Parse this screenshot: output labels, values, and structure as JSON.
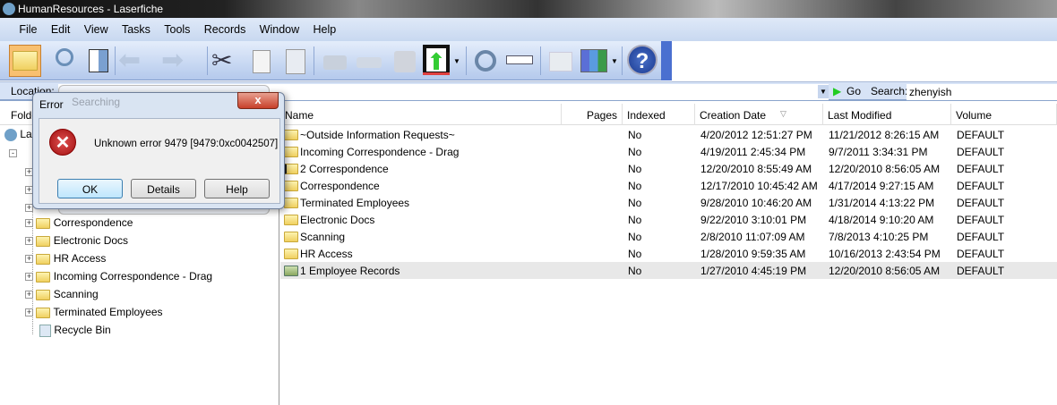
{
  "window": {
    "title": "HumanResources - Laserfiche"
  },
  "menu": [
    "File",
    "Edit",
    "View",
    "Tasks",
    "Tools",
    "Records",
    "Window",
    "Help"
  ],
  "locbar": {
    "location_label": "Location:",
    "go_label": "Go",
    "search_label": "Search:",
    "search_value": "zhenyish"
  },
  "leftpane": {
    "header": "Folders",
    "root": "Laserfiche",
    "children": [
      "Correspondence",
      "Electronic Docs",
      "HR Access",
      "Incoming Correspondence - Drag",
      "Scanning",
      "Terminated Employees",
      "Recycle Bin"
    ]
  },
  "columns": [
    "Name",
    "Pages",
    "Indexed",
    "Creation Date",
    "Last Modified",
    "Volume"
  ],
  "rows": [
    {
      "name": "~Outside Information Requests~",
      "pages": "",
      "indexed": "No",
      "created": "4/20/2012 12:51:27 PM",
      "modified": "11/21/2012 8:26:15 AM",
      "volume": "DEFAULT"
    },
    {
      "name": "Incoming Correspondence - Drag",
      "pages": "",
      "indexed": "No",
      "created": "4/19/2011 2:45:34 PM",
      "modified": "9/7/2011 3:34:31 PM",
      "volume": "DEFAULT"
    },
    {
      "name": "2 Correspondence",
      "pages": "",
      "indexed": "No",
      "created": "12/20/2010 8:55:49 AM",
      "modified": "12/20/2010 8:56:05 AM",
      "volume": "DEFAULT"
    },
    {
      "name": "Correspondence",
      "pages": "",
      "indexed": "No",
      "created": "12/17/2010 10:45:42 AM",
      "modified": "4/17/2014 9:27:15 AM",
      "volume": "DEFAULT"
    },
    {
      "name": "Terminated Employees",
      "pages": "",
      "indexed": "No",
      "created": "9/28/2010 10:46:20 AM",
      "modified": "1/31/2014 4:13:22 PM",
      "volume": "DEFAULT"
    },
    {
      "name": "Electronic Docs",
      "pages": "",
      "indexed": "No",
      "created": "9/22/2010 3:10:01 PM",
      "modified": "4/18/2014 9:10:20 AM",
      "volume": "DEFAULT"
    },
    {
      "name": "Scanning",
      "pages": "",
      "indexed": "No",
      "created": "2/8/2010 11:07:09 AM",
      "modified": "7/8/2013 4:10:25 PM",
      "volume": "DEFAULT"
    },
    {
      "name": "HR Access",
      "pages": "",
      "indexed": "No",
      "created": "1/28/2010 9:59:35 AM",
      "modified": "10/16/2013 2:43:54 PM",
      "volume": "DEFAULT"
    },
    {
      "name": "1 Employee Records",
      "pages": "",
      "indexed": "No",
      "created": "1/27/2010 4:45:19 PM",
      "modified": "12/20/2010 8:56:05 AM",
      "volume": "DEFAULT"
    }
  ],
  "dialog": {
    "title": "Error",
    "behind_title": "Searching",
    "message": "Unknown error 9479 [9479:0xc0042507]",
    "ok": "OK",
    "details": "Details",
    "help": "Help",
    "close": "x"
  }
}
